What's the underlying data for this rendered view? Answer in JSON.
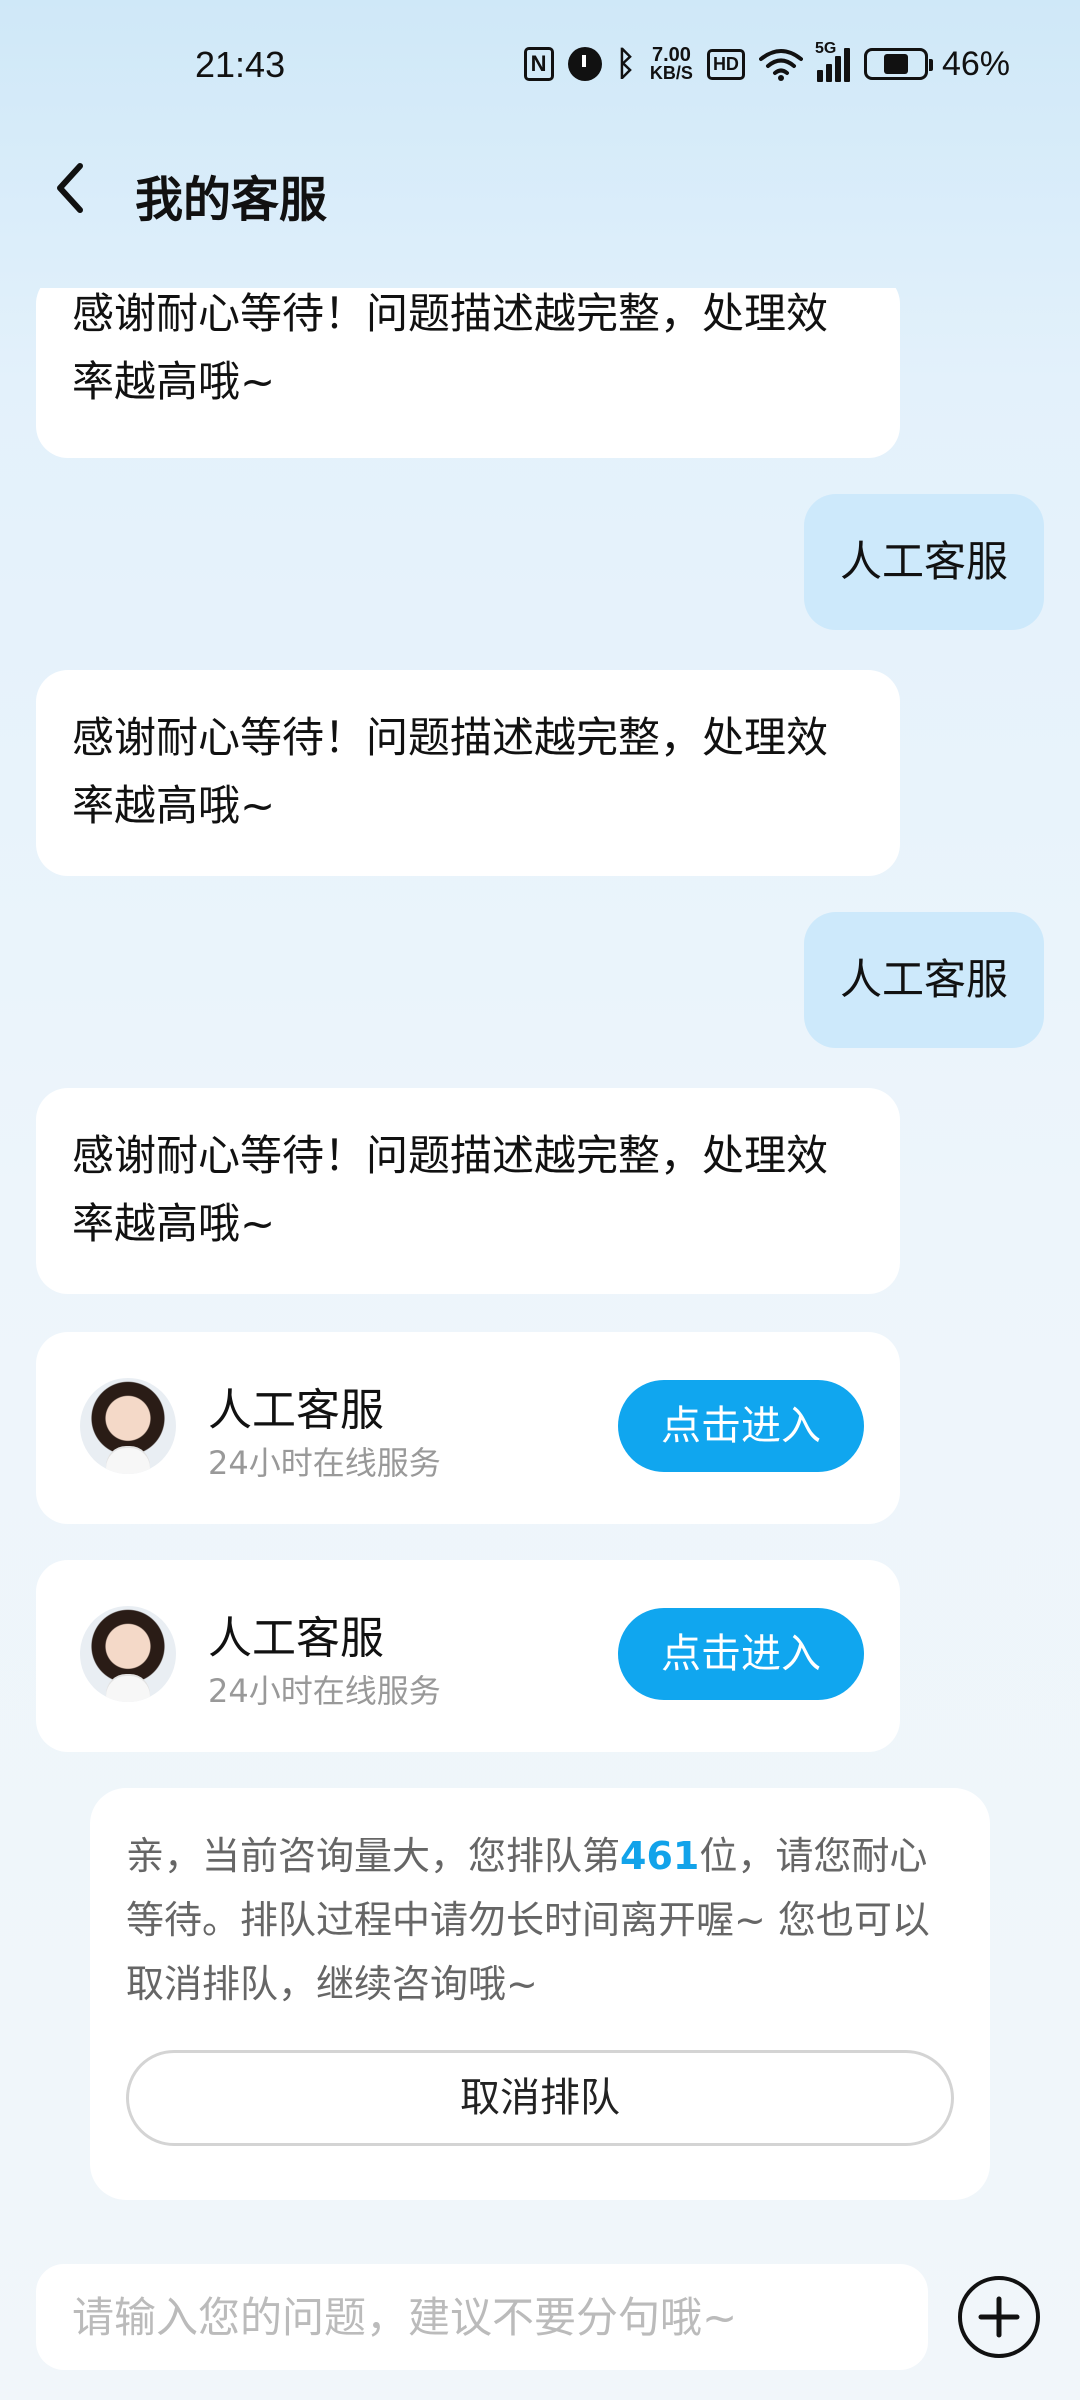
{
  "status_bar": {
    "time": "21:43",
    "nfc_label": "N",
    "net_speed_value": "7.00",
    "net_speed_unit": "KB/S",
    "hd_label": "HD",
    "network_label": "5G",
    "battery_percent": "46%",
    "battery_level": 0.46
  },
  "header": {
    "title": "我的客服"
  },
  "messages": [
    {
      "side": "left",
      "text": "感谢耐心等待！问题描述越完整，处理效率越高哦~"
    },
    {
      "side": "right",
      "text": "人工客服"
    },
    {
      "side": "left",
      "text": "感谢耐心等待！问题描述越完整，处理效率越高哦~"
    },
    {
      "side": "right",
      "text": "人工客服"
    },
    {
      "side": "left",
      "text": "感谢耐心等待！问题描述越完整，处理效率越高哦~"
    }
  ],
  "agent_cards": [
    {
      "name": "人工客服",
      "subtitle": "24小时在线服务",
      "button_label": "点击进入"
    },
    {
      "name": "人工客服",
      "subtitle": "24小时在线服务",
      "button_label": "点击进入"
    }
  ],
  "queue": {
    "text_before": "亲，当前咨询量大，您排队第",
    "position": "461",
    "text_after": "位，请您耐心等待。排队过程中请勿长时间离开喔~ 您也可以取消排队，继续咨询哦~",
    "cancel_label": "取消排队"
  },
  "input": {
    "placeholder": "请输入您的问题，建议不要分句哦~",
    "value": ""
  },
  "colors": {
    "accent": "#10a6ef",
    "user_bubble": "#cde9fb",
    "queue_number": "#12a3ea"
  }
}
